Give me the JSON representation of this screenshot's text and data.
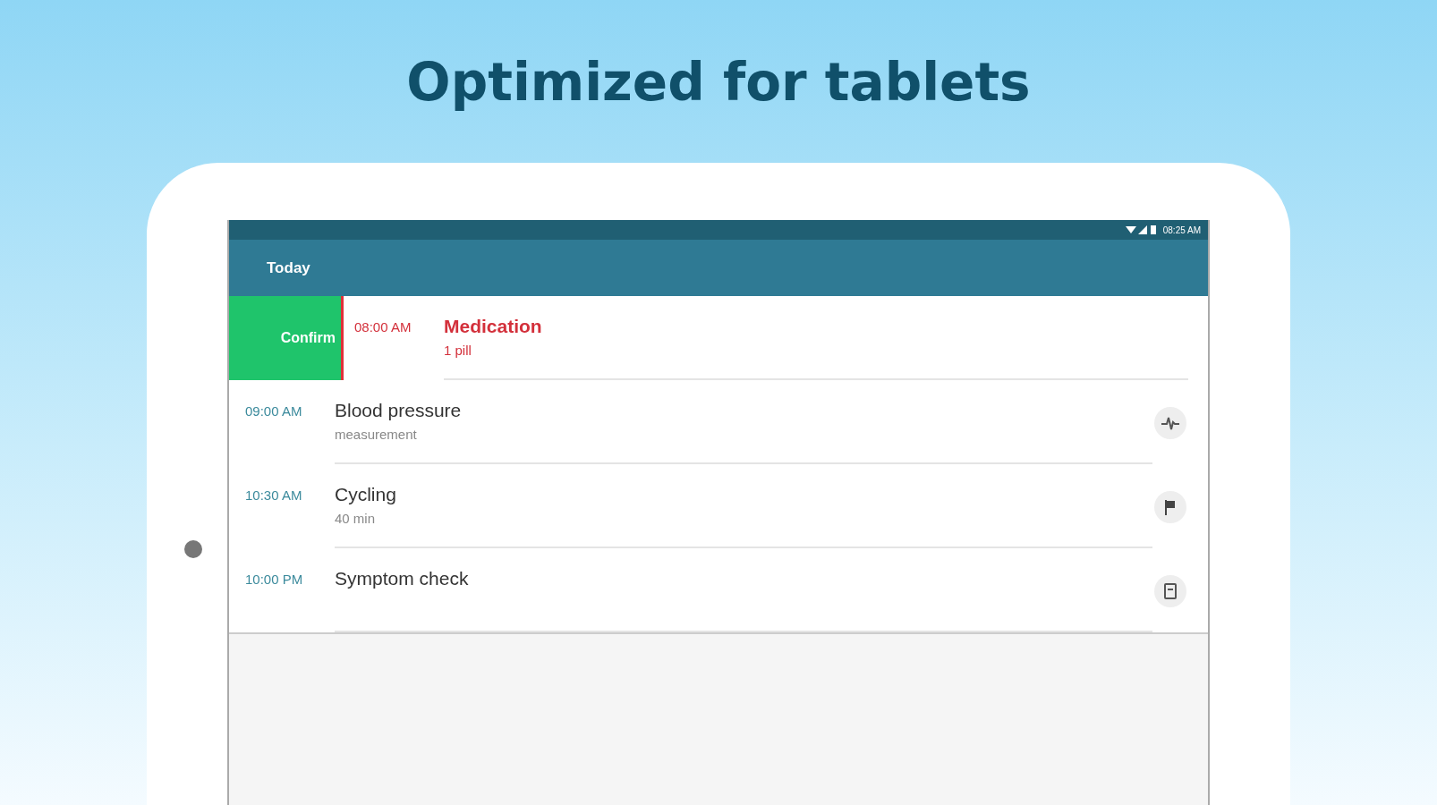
{
  "headline": "Optimized for tablets",
  "status_bar": {
    "time": "08:25 AM"
  },
  "app_bar": {
    "title": "Today"
  },
  "items": [
    {
      "time": "08:00 AM",
      "title": "Medication",
      "subtitle": "1 pill",
      "kind": "medication",
      "overdue": true,
      "swipe_action": "Confirm"
    },
    {
      "time": "09:00 AM",
      "title": "Blood pressure",
      "subtitle": "measurement",
      "kind": "measurement",
      "overdue": false
    },
    {
      "time": "10:30 AM",
      "title": "Cycling",
      "subtitle": "40 min",
      "kind": "activity",
      "overdue": false
    },
    {
      "time": "10:00 PM",
      "title": "Symptom check",
      "kind": "questionnaire",
      "overdue": false
    }
  ]
}
